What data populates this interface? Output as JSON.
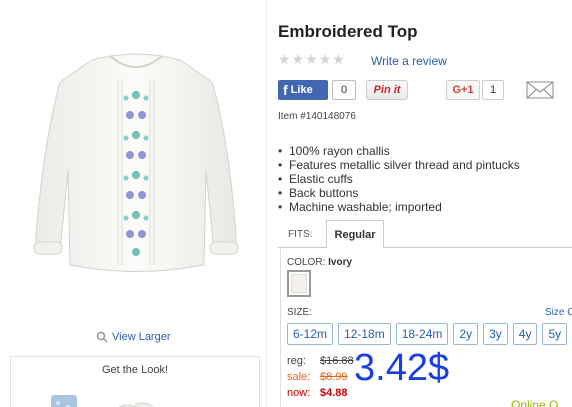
{
  "product": {
    "title": "Embroidered Top",
    "write_review": "Write a review",
    "item_number": "Item #140148076",
    "view_larger": "View Larger",
    "get_the_look": "Get the Look!",
    "features": [
      "100% rayon challis",
      "Features metallic silver thread and pintucks",
      "Elastic cuffs",
      "Back buttons",
      "Machine washable; imported"
    ]
  },
  "rating": {
    "stars": 0,
    "max": 5
  },
  "social": {
    "fb_label": "Like",
    "fb_icon": "f",
    "fb_count": "0",
    "pinit_label": "Pin it",
    "gplus_label": "G+1",
    "gplus_count": "1"
  },
  "fits": {
    "label": "FITS:",
    "tabs": [
      "Regular"
    ]
  },
  "color": {
    "label": "COLOR:",
    "selected": "Ivory",
    "swatch_hex": "#f4f1ea"
  },
  "size": {
    "label": "SIZE:",
    "chart_link": "Size C",
    "options": [
      "6-12m",
      "12-18m",
      "18-24m",
      "2y",
      "3y",
      "4y",
      "5y"
    ]
  },
  "price": {
    "reg_label": "reg:",
    "reg_value": "$16.88",
    "sale_label": "sale:",
    "sale_value": "$8.99",
    "now_label": "now:",
    "now_value": "$4.88",
    "overlay": "3.42$",
    "online_only": "Online O"
  },
  "colors": {
    "link": "#2a5db0",
    "sale": "#e8641b",
    "now": "#cc0000",
    "overlay": "#1a3fe0",
    "facebook": "#4267b2"
  }
}
